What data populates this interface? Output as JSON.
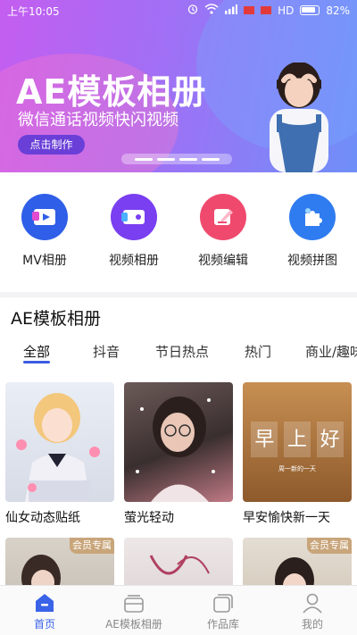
{
  "statusbar": {
    "time": "上午10:05",
    "network": "HD",
    "battery": "82%"
  },
  "banner": {
    "title": "AE模板相册",
    "subtitle": "微信通话视频快闪视频",
    "button": "点击制作"
  },
  "tools": [
    {
      "label": "MV相册",
      "icon": "mv-video-icon",
      "color": "#2f5fe8"
    },
    {
      "label": "视频相册",
      "icon": "video-album-icon",
      "color": "#7a3ff0"
    },
    {
      "label": "视频编辑",
      "icon": "video-edit-icon",
      "color": "#ef4a6e"
    },
    {
      "label": "视频拼图",
      "icon": "puzzle-icon",
      "color": "#2f7cf0"
    }
  ],
  "section": {
    "title": "AE模板相册"
  },
  "tabs": [
    "全部",
    "抖音",
    "节日热点",
    "热门",
    "商业/趣味"
  ],
  "cards": [
    {
      "title": "仙女动态贴纸"
    },
    {
      "title": "萤光轻动"
    },
    {
      "title": "早安愉快新一天",
      "image_text": [
        "早",
        "上",
        "好"
      ],
      "image_caption": "周一新的一天"
    },
    {
      "badge": "会员专属"
    },
    {
      "badge": ""
    },
    {
      "badge": "会员专属"
    }
  ],
  "bottomnav": [
    {
      "label": "首页",
      "icon": "home-icon",
      "active": true
    },
    {
      "label": "AE模板相册",
      "icon": "template-icon",
      "active": false
    },
    {
      "label": "作品库",
      "icon": "works-icon",
      "active": false
    },
    {
      "label": "我的",
      "icon": "profile-icon",
      "active": false
    }
  ]
}
